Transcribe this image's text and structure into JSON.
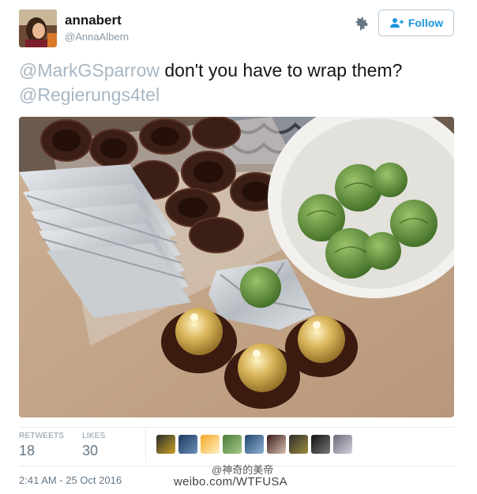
{
  "header": {
    "display_name": "annabert",
    "handle": "@AnnaAlbern",
    "follow_label": "Follow"
  },
  "tweet": {
    "mention_1": "@MarkGSparrow",
    "body": " don't you have to wrap them?",
    "mention_2": "@Regierungs4tel"
  },
  "stats": {
    "retweets_label": "RETWEETS",
    "retweets_value": "18",
    "likes_label": "LIKES",
    "likes_value": "30"
  },
  "timestamp": "2:41 AM - 25 Oct 2016",
  "watermark": {
    "line1": "@神奇的美帝",
    "line2": "weibo.com/WTFUSA"
  },
  "icons": [
    "avatar",
    "gear-icon",
    "follow-person-plus-icon",
    "liker-avatars"
  ],
  "colors": {
    "link": "#1b95e0",
    "mention": "#a7b6c2",
    "muted": "#8899a6"
  }
}
